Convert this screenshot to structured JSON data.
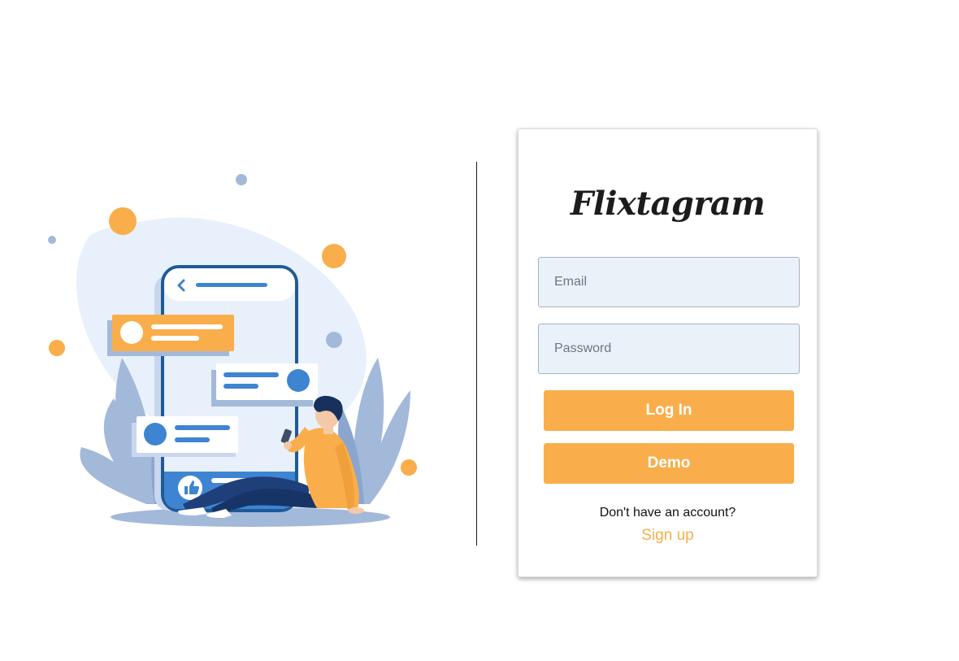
{
  "brand": {
    "name": "Flixtagram"
  },
  "form": {
    "email_placeholder": "Email",
    "password_placeholder": "Password",
    "login_label": "Log In",
    "demo_label": "Demo"
  },
  "footer": {
    "no_account_text": "Don't have an account?",
    "signup_label": "Sign up"
  },
  "colors": {
    "accent": "#f9ae4b",
    "field_bg": "#e9f1f9",
    "illustration_blue": "#3e84d1",
    "illustration_light": "#e8f0fb",
    "illustration_muted": "#a3b9d9"
  },
  "illustration": {
    "icons": [
      "like-icon",
      "back-arrow-icon",
      "phone",
      "person"
    ]
  }
}
